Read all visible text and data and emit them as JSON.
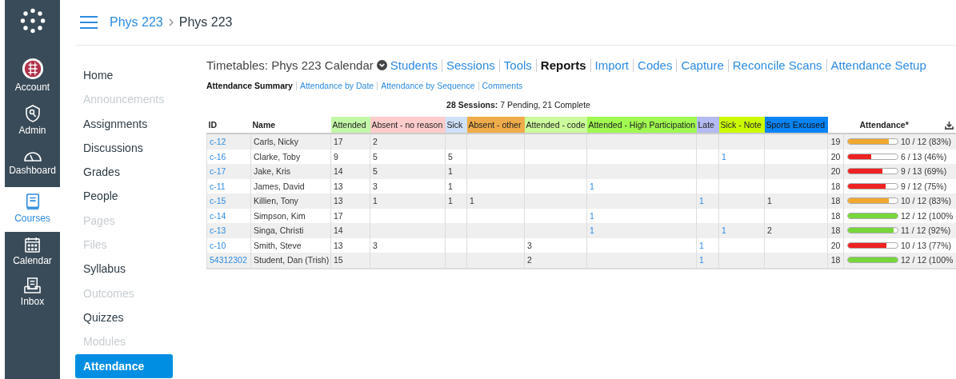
{
  "global_nav": [
    {
      "label": "Account",
      "selected": false
    },
    {
      "label": "Admin",
      "selected": false
    },
    {
      "label": "Dashboard",
      "selected": false
    },
    {
      "label": "Courses",
      "selected": true
    },
    {
      "label": "Calendar",
      "selected": false
    },
    {
      "label": "Inbox",
      "selected": false
    }
  ],
  "breadcrumb": [
    "Phys 223",
    "Phys 223"
  ],
  "course_nav": [
    {
      "label": "Home",
      "disabled": false,
      "selected": false
    },
    {
      "label": "Announcements",
      "disabled": true,
      "selected": false
    },
    {
      "label": "Assignments",
      "disabled": false,
      "selected": false
    },
    {
      "label": "Discussions",
      "disabled": false,
      "selected": false
    },
    {
      "label": "Grades",
      "disabled": false,
      "selected": false
    },
    {
      "label": "People",
      "disabled": false,
      "selected": false
    },
    {
      "label": "Pages",
      "disabled": true,
      "selected": false
    },
    {
      "label": "Files",
      "disabled": true,
      "selected": false
    },
    {
      "label": "Syllabus",
      "disabled": false,
      "selected": false
    },
    {
      "label": "Outcomes",
      "disabled": true,
      "selected": false
    },
    {
      "label": "Quizzes",
      "disabled": false,
      "selected": false
    },
    {
      "label": "Modules",
      "disabled": true,
      "selected": false
    },
    {
      "label": "Attendance",
      "disabled": false,
      "selected": true
    }
  ],
  "tool_title": "Timetables: Phys 223 Calendar",
  "tool_menu": [
    {
      "label": "Students",
      "selected": false
    },
    {
      "label": "Sessions",
      "selected": false
    },
    {
      "label": "Tools",
      "selected": false
    },
    {
      "label": "Reports",
      "selected": true
    },
    {
      "label": "Import",
      "selected": false
    },
    {
      "label": "Codes",
      "selected": false
    },
    {
      "label": "Capture",
      "selected": false
    },
    {
      "label": "Reconcile Scans",
      "selected": false
    },
    {
      "label": "Attendance Setup",
      "selected": false
    }
  ],
  "report_tabs": [
    {
      "label": "Attendance Summary",
      "selected": true
    },
    {
      "label": "Attendance by Date",
      "selected": false
    },
    {
      "label": "Attendance by Sequence",
      "selected": false
    },
    {
      "label": "Comments",
      "selected": false
    }
  ],
  "sessions_summary": "**28 Sessions:** 7 Pending, 21 Complete",
  "table": {
    "id_heading": "ID",
    "name_heading": "Name",
    "attendance_heading": "Attendance*",
    "columns": {
      "attended": {
        "label": "Attended",
        "color": "#c2f7a8",
        "link": false
      },
      "absent_no_reason": {
        "label": "Absent - no reason",
        "color": "#ffcccc",
        "link": false
      },
      "sick": {
        "label": "Sick",
        "color": "#cfe0fa",
        "link": false
      },
      "absent_other": {
        "label": "Absent - other",
        "color": "#efac4a",
        "link": false
      },
      "attended_code": {
        "label": "Attended - code",
        "color": "#ccfa9c",
        "link": false
      },
      "attended_high_participation": {
        "label": "Attended - High Participation",
        "color": "#a0f850",
        "link": true
      },
      "late": {
        "label": "Late",
        "color": "#b4baf2",
        "link": true
      },
      "sick_note": {
        "label": "Sick - Note",
        "color": "#ccfa00",
        "link": true
      },
      "sports_excused": {
        "label": "Sports Excused",
        "color": "#0a84f5",
        "link": false
      }
    },
    "rows": [
      {
        "id": "c-12",
        "name": "Carls, Nicky",
        "counts": {
          "attended": "17",
          "absent_no_reason": "2"
        },
        "total": "19",
        "level": 0.83,
        "color": "#f0a830",
        "reading": "10 / 12 (83%)"
      },
      {
        "id": "c-16",
        "name": "Clarke, Toby",
        "counts": {
          "attended": "9",
          "absent_no_reason": "5",
          "sick": "5",
          "sick_note": "1"
        },
        "total": "20",
        "level": 0.46,
        "color": "#ee2222",
        "reading": "6 / 13 (46%)"
      },
      {
        "id": "c-17",
        "name": "Jake, Kris",
        "counts": {
          "attended": "14",
          "absent_no_reason": "5",
          "sick": "1"
        },
        "total": "20",
        "level": 0.69,
        "color": "#ee2222",
        "reading": "9 / 13 (69%)"
      },
      {
        "id": "c-11",
        "name": "James, David",
        "counts": {
          "attended": "13",
          "absent_no_reason": "3",
          "sick": "1",
          "attended_high_participation": "1"
        },
        "total": "18",
        "level": 0.75,
        "color": "#ee2222",
        "reading": "9 / 12 (75%)"
      },
      {
        "id": "c-15",
        "name": "Killien, Tony",
        "counts": {
          "attended": "13",
          "absent_no_reason": "1",
          "sick": "1",
          "absent_other": "1",
          "late": "1",
          "sports_excused": "1"
        },
        "total": "18",
        "level": 0.83,
        "color": "#f0a830",
        "reading": "10 / 12 (83%)"
      },
      {
        "id": "c-14",
        "name": "Simpson, Kim",
        "counts": {
          "attended": "17",
          "attended_high_participation": "1"
        },
        "total": "18",
        "level": 1,
        "color": "#77d63a",
        "reading": "12 / 12 (100%"
      },
      {
        "id": "c-13",
        "name": "Singa, Christi",
        "counts": {
          "attended": "14",
          "attended_high_participation": "1",
          "sick_note": "1",
          "sports_excused": "2"
        },
        "total": "18",
        "level": 0.92,
        "color": "#77d63a",
        "reading": "11 / 12 (92%)"
      },
      {
        "id": "c-10",
        "name": "Smith, Steve",
        "counts": {
          "attended": "13",
          "absent_no_reason": "3",
          "attended_code": "3",
          "late": "1"
        },
        "total": "20",
        "level": 0.77,
        "color": "#ee2222",
        "reading": "10 / 13 (77%)"
      },
      {
        "id": "54312302",
        "name": "Student, Dan (Trish)",
        "counts": {
          "attended": "15",
          "attended_code": "2",
          "late": "1"
        },
        "total": "18",
        "level": 1,
        "color": "#77d63a",
        "reading": "12 / 12 (100%"
      }
    ]
  }
}
